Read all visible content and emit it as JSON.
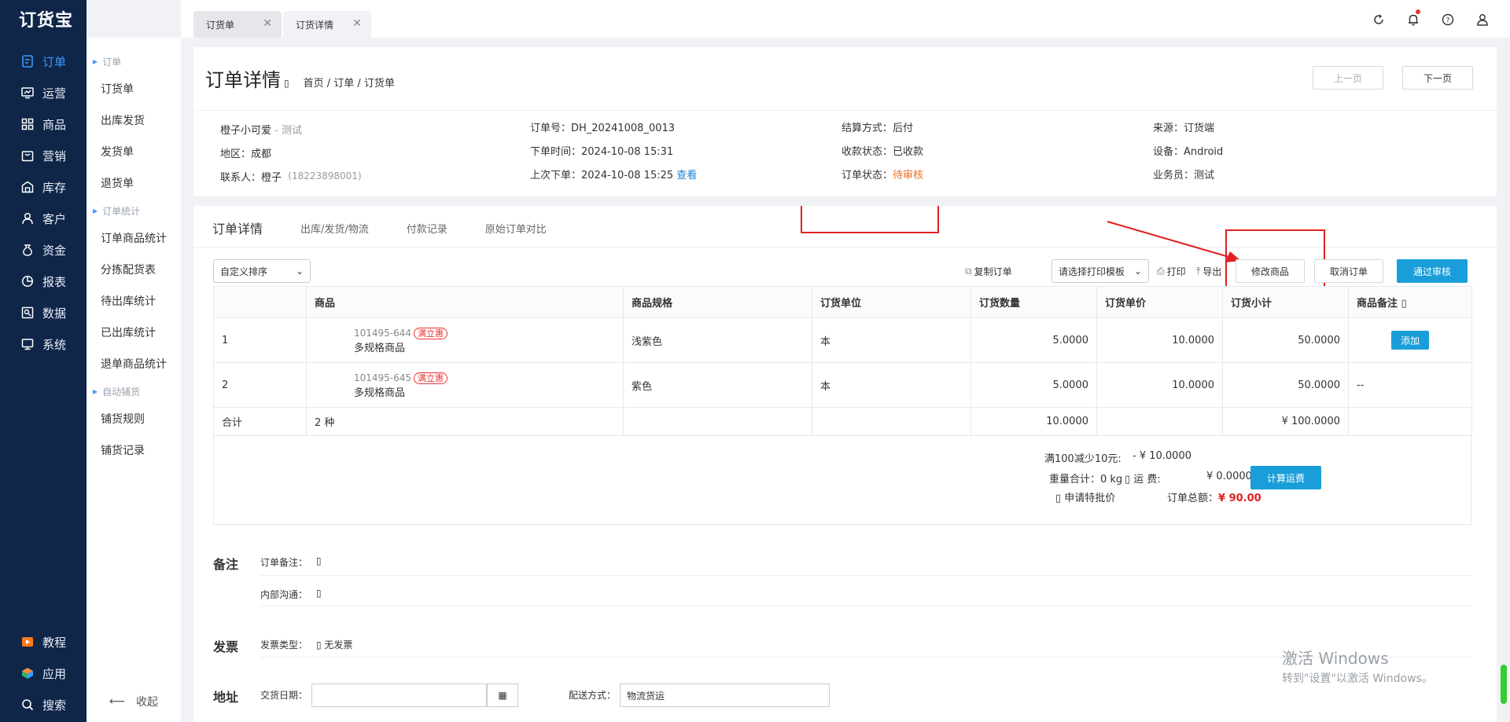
{
  "app": {
    "logo": "订货宝"
  },
  "nav": {
    "items": [
      {
        "label": "订单",
        "icon": "order-icon"
      },
      {
        "label": "运营",
        "icon": "operation-icon"
      },
      {
        "label": "商品",
        "icon": "goods-icon"
      },
      {
        "label": "营销",
        "icon": "marketing-icon"
      },
      {
        "label": "库存",
        "icon": "warehouse-icon"
      },
      {
        "label": "客户",
        "icon": "customer-icon"
      },
      {
        "label": "资金",
        "icon": "money-icon"
      },
      {
        "label": "报表",
        "icon": "report-icon"
      },
      {
        "label": "数据",
        "icon": "data-icon"
      },
      {
        "label": "系统",
        "icon": "system-icon"
      }
    ],
    "bottom": [
      {
        "label": "教程",
        "icon": "tutorial-icon"
      },
      {
        "label": "应用",
        "icon": "apps-icon"
      },
      {
        "label": "搜索",
        "icon": "search-icon"
      }
    ],
    "active_color": "#3d9cff"
  },
  "submenu": {
    "group1": "订单",
    "items1": [
      "订货单",
      "出库发货",
      "发货单",
      "退货单"
    ],
    "group2": "订单统计",
    "items2": [
      "订单商品统计",
      "分拣配货表",
      "待出库统计",
      "已出库统计",
      "退单商品统计"
    ],
    "group3": "自动铺货",
    "items3": [
      "铺货规则",
      "铺货记录"
    ],
    "collapse": "收起"
  },
  "tabs": [
    {
      "label": "订货单"
    },
    {
      "label": "订货详情"
    }
  ],
  "header": {
    "title": "订单详情",
    "breadcrumb": "首页 / 订单 / 订货单",
    "prev": "上一页",
    "next": "下一页"
  },
  "info": {
    "customer": "橙子小可爱",
    "customer_tag": "- 测试",
    "region": "地区：成都",
    "contact": "联系人：橙子",
    "phone": "(18223898001)",
    "order_no": "订单号：DH_20241008_0013",
    "order_time": "下单时间：2024-10-08 15:31",
    "last_order": "上次下单：2024-10-08 15:25",
    "view": "查看",
    "settle": "结算方式：后付",
    "pay_status": "收款状态：已收款",
    "order_status_label": "订单状态：",
    "order_status_value": "待审核",
    "source": "来源：订货端",
    "device": "设备：Android",
    "salesman": "业务员：测试"
  },
  "detail_tabs": [
    "订单详情",
    "出库/发货/物流",
    "付款记录",
    "原始订单对比"
  ],
  "toolbar": {
    "sort": "自定义排序",
    "copy": "复制订单",
    "template": "请选择打印模板",
    "print": "打印",
    "export": "导出",
    "modify": "修改商品",
    "cancel": "取消订单",
    "approve": "通过审核"
  },
  "table": {
    "headers": [
      "",
      "商品",
      "商品规格",
      "订货单位",
      "订货数量",
      "订货单价",
      "订货小计",
      "商品备注 ▯"
    ],
    "rows": [
      {
        "idx": "1",
        "sku": "101495-644",
        "tag": "满立惠",
        "name": "多规格商品",
        "spec": "浅紫色",
        "unit": "本",
        "qty": "5.0000",
        "price": "10.0000",
        "subtotal": "50.0000",
        "note": "添加"
      },
      {
        "idx": "2",
        "sku": "101495-645",
        "tag": "满立惠",
        "name": "多规格商品",
        "spec": "紫色",
        "unit": "本",
        "qty": "5.0000",
        "price": "10.0000",
        "subtotal": "50.0000",
        "note": "--"
      }
    ],
    "total": {
      "label": "合计",
      "kinds": "2 种",
      "qty": "10.0000",
      "subtotal": "¥ 100.0000"
    }
  },
  "summary": {
    "discount_label": "满100减少10元:",
    "discount_value": "- ¥ 10.0000",
    "weight": "重量合计：0 kg",
    "freight_label": "▯ 运    费:",
    "freight_value": "¥ 0.0000",
    "calc": "计算运费",
    "special": "▯ 申请特批价",
    "total_label": "订单总额：",
    "total_value": "¥ 90.00"
  },
  "remark": {
    "title": "备注",
    "order_note": "订单备注：",
    "order_note_val": "▯",
    "internal": "内部沟通：",
    "internal_val": "▯"
  },
  "invoice": {
    "title": "发票",
    "type_label": "发票类型：",
    "type_value": "▯ 无发票"
  },
  "address": {
    "title": "地址",
    "date_label": "交货日期：",
    "ship_label": "配送方式：",
    "ship_value": "物流货运"
  },
  "watermark": {
    "line1": "激活 Windows",
    "line2": "转到\"设置\"以激活 Windows。"
  }
}
